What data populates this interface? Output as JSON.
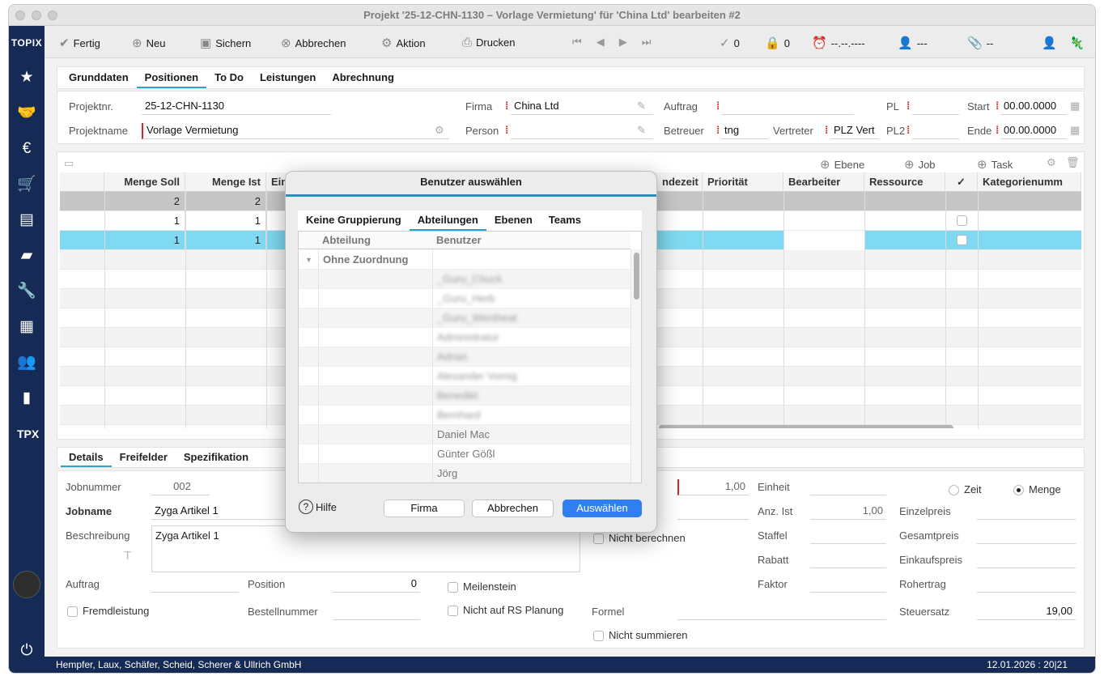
{
  "window": {
    "title": "Projekt '25-12-CHN-1130 – Vorlage Vermietung' für 'China Ltd' bearbeiten #2"
  },
  "sidebar": {
    "brand": "TOPIX",
    "icons": [
      "star-icon",
      "handshake-icon",
      "invoice-icon",
      "cart-icon",
      "warehouse-icon",
      "archive-icon",
      "wrench-icon",
      "calculator-icon",
      "people-icon",
      "bar-chart-icon",
      "tpx-icon",
      "power-icon"
    ]
  },
  "toolbar": {
    "fertig": "Fertig",
    "neu": "Neu",
    "sichern": "Sichern",
    "abbrechen": "Abbrechen",
    "aktion": "Aktion",
    "drucken": "Drucken",
    "check_count": "0",
    "lock_count": "0",
    "alarm_date": "--.--.----",
    "user_placeholder": "---",
    "attach_count": "--"
  },
  "main_tabs": [
    "Grunddaten",
    "Positionen",
    "To Do",
    "Leistungen",
    "Abrechnung"
  ],
  "header_fields": {
    "projektnr_label": "Projektnr.",
    "projektnr": "25-12-CHN-1130",
    "projektname_label": "Projektname",
    "projektname": "Vorlage Vermietung",
    "firma_label": "Firma",
    "firma": "China Ltd",
    "person_label": "Person",
    "person": "",
    "auftrag_label": "Auftrag",
    "auftrag": "",
    "betreuer_label": "Betreuer",
    "betreuer": "tng",
    "vertreter_label": "Vertreter",
    "vertreter": "PLZ Vert",
    "pl_label": "PL",
    "pl": "",
    "pl2_label": "PL2",
    "pl2": "",
    "start_label": "Start",
    "start": "00.00.0000",
    "ende_label": "Ende",
    "ende": "00.00.0000"
  },
  "grid_toolbar": {
    "ebene": "Ebene",
    "job": "Job",
    "task": "Task"
  },
  "grid": {
    "columns": [
      "",
      "Menge Soll",
      "Menge Ist",
      "Ein",
      "ndezeit",
      "Priorität",
      "Bearbeiter",
      "Ressource",
      "✓",
      "Kategorienumm"
    ],
    "rows": [
      {
        "soll": "2",
        "ist": "2"
      },
      {
        "soll": "1",
        "ist": "1"
      },
      {
        "soll": "1",
        "ist": "1"
      }
    ]
  },
  "detail_tabs": [
    "Details",
    "Freifelder",
    "Spezifikation"
  ],
  "details": {
    "jobnummer_label": "Jobnummer",
    "jobnummer": "002",
    "jobname_label": "Jobname",
    "jobname": "Zyga Artikel 1",
    "beschreibung_label": "Beschreibung",
    "beschreibung": "Zyga Artikel 1",
    "auftrag_label": "Auftrag",
    "position_label": "Position",
    "position": "0",
    "fremdleistung": "Fremdleistung",
    "bestellnummer_label": "Bestellnummer",
    "meilenstein": "Meilenstein",
    "nicht_rs": "Nicht auf RS Planung",
    "menge_val": "1,00",
    "nicht_berechnen": "Nicht berechnen",
    "formel_label": "Formel",
    "nicht_summieren": "Nicht summieren",
    "einheit_label": "Einheit",
    "anz_ist_label": "Anz. Ist",
    "anz_ist": "1,00",
    "staffel_label": "Staffel",
    "rabatt_label": "Rabatt",
    "faktor_label": "Faktor",
    "zeit_label": "Zeit",
    "menge_label": "Menge",
    "einzelpreis_label": "Einzelpreis",
    "gesamtpreis_label": "Gesamtpreis",
    "einkaufspreis_label": "Einkaufspreis",
    "rohertrag_label": "Rohertrag",
    "steuersatz_label": "Steuersatz",
    "steuersatz": "19,00"
  },
  "status": {
    "company": "Hempfer, Laux, Schäfer, Scheid, Scherer & Ullrich GmbH",
    "datetime": "12.01.2026 : 20|21"
  },
  "dialog": {
    "title": "Benutzer auswählen",
    "tabs": [
      "Keine Gruppierung",
      "Abteilungen",
      "Ebenen",
      "Teams"
    ],
    "col_abteilung": "Abteilung",
    "col_benutzer": "Benutzer",
    "group": "Ohne Zuordnung",
    "users_blurred": [
      "_Guru_Chuck",
      "_Guru_Herb",
      "_Guru_Wentheat",
      "Administrator",
      "Adrian",
      "Alexander Vornig",
      "Benedikt",
      "Bernhard"
    ],
    "users": [
      "Daniel Mac",
      "Günter Gößl",
      "Jörg"
    ],
    "hilfe": "Hilfe",
    "firma_button": "Firma",
    "abbrechen_button": "Abbrechen",
    "auswaehlen_button": "Auswählen"
  }
}
